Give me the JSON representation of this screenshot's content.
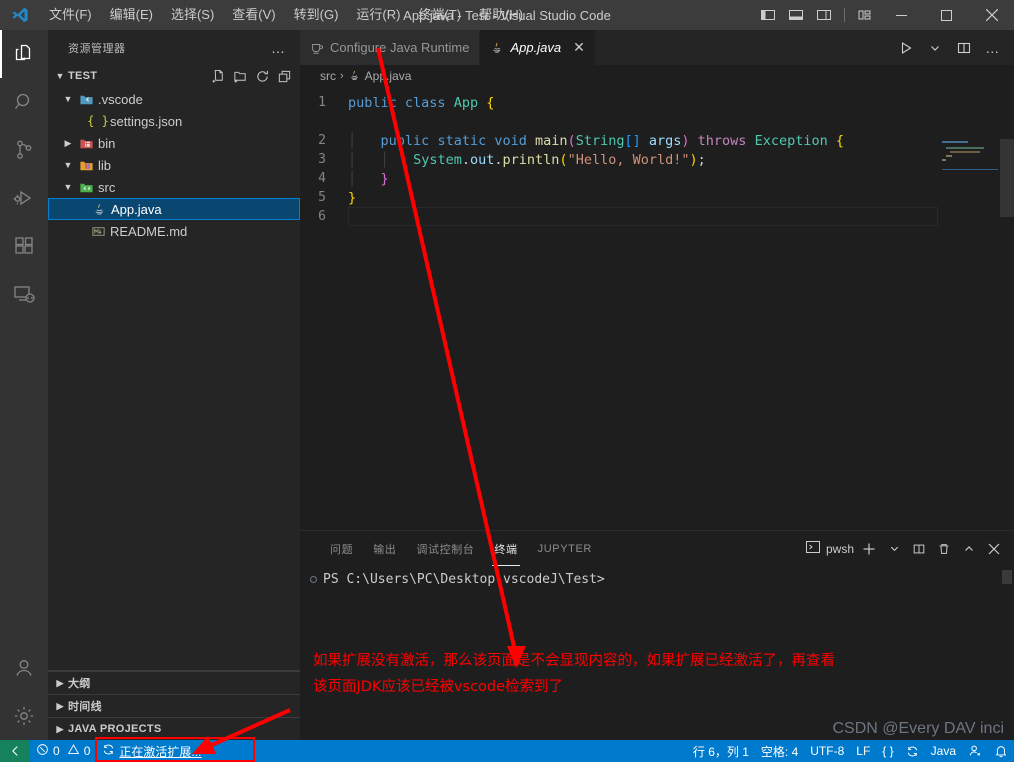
{
  "window": {
    "title": "App.java - Test - Visual Studio Code",
    "menus": [
      "文件(F)",
      "编辑(E)",
      "选择(S)",
      "查看(V)",
      "转到(G)",
      "运行(R)",
      "终端(T)",
      "帮助(H)"
    ],
    "controls": {
      "toggle_primary_sidebar": "toggle-primary-sidebar-icon",
      "toggle_panel": "toggle-panel-icon",
      "toggle_secondary_sidebar": "toggle-secondary-sidebar-icon",
      "customize_layout": "customize-layout-icon",
      "minimize": "–",
      "maximize": "▢",
      "close": "✕"
    }
  },
  "activitybar": {
    "items": [
      {
        "name": "explorer",
        "icon": "files-icon",
        "active": true
      },
      {
        "name": "search",
        "icon": "search-icon",
        "active": false
      },
      {
        "name": "source-control",
        "icon": "source-control-icon",
        "active": false
      },
      {
        "name": "run-and-debug",
        "icon": "run-debug-icon",
        "active": false
      },
      {
        "name": "extensions",
        "icon": "extensions-icon",
        "active": false
      },
      {
        "name": "remote-explorer",
        "icon": "remote-explorer-icon",
        "active": false
      }
    ],
    "bottom": [
      {
        "name": "accounts",
        "icon": "account-icon"
      },
      {
        "name": "manage",
        "icon": "gear-icon"
      }
    ]
  },
  "sidebar": {
    "title": "资源管理器",
    "more_actions": "…",
    "folder": {
      "name": "TEST",
      "expanded": true,
      "actions": [
        "new-file-icon",
        "new-folder-icon",
        "refresh-icon",
        "collapse-all-icon"
      ]
    },
    "tree": [
      {
        "label": ".vscode",
        "icon": "folder-vscode-icon",
        "indent": 1,
        "twisty": "▾",
        "selected": false
      },
      {
        "label": "settings.json",
        "icon": "json-icon",
        "indent": 2,
        "twisty": "",
        "selected": false
      },
      {
        "label": "bin",
        "icon": "folder-bin-icon",
        "indent": 1,
        "twisty": "▸",
        "selected": false
      },
      {
        "label": "lib",
        "icon": "folder-lib-icon",
        "indent": 1,
        "twisty": "▾",
        "selected": false
      },
      {
        "label": "src",
        "icon": "folder-src-icon",
        "indent": 1,
        "twisty": "▾",
        "selected": false
      },
      {
        "label": "App.java",
        "icon": "java-icon",
        "indent": 2,
        "twisty": "",
        "selected": true
      },
      {
        "label": "README.md",
        "icon": "markdown-icon",
        "indent": 2,
        "twisty": "",
        "selected": false
      }
    ],
    "sections": [
      {
        "label": "大纲",
        "twisty": "▸"
      },
      {
        "label": "时间线",
        "twisty": "▸"
      },
      {
        "label": "JAVA PROJECTS",
        "twisty": "▸"
      }
    ]
  },
  "editor": {
    "tabs": [
      {
        "label": "Configure Java Runtime",
        "icon": "coffee-icon",
        "active": false,
        "closable": false
      },
      {
        "label": "App.java",
        "icon": "java-icon",
        "active": true,
        "closable": true,
        "close": "✕"
      }
    ],
    "actions": [
      "run-icon",
      "chevron-down-icon",
      "split-editor-icon",
      "more-actions-icon"
    ],
    "breadcrumbs": [
      {
        "label": "src",
        "icon": ""
      },
      {
        "label": "App.java",
        "icon": "java-icon"
      }
    ],
    "breadcrumb_sep": "›",
    "lines": [
      {
        "num": "1",
        "text": "public class App {"
      },
      {
        "num": "",
        "text": ""
      },
      {
        "num": "2",
        "text": "    public static void main(String[] args) throws Exception {"
      },
      {
        "num": "3",
        "text": "        System.out.println(\"Hello, World!\");"
      },
      {
        "num": "4",
        "text": "    }"
      },
      {
        "num": "5",
        "text": "}"
      },
      {
        "num": "6",
        "text": ""
      }
    ]
  },
  "panel": {
    "tabs": [
      {
        "label": "问题",
        "active": false
      },
      {
        "label": "输出",
        "active": false
      },
      {
        "label": "调试控制台",
        "active": false
      },
      {
        "label": "终端",
        "active": true
      },
      {
        "label": "JUPYTER",
        "active": false
      }
    ],
    "terminal_name": "pwsh",
    "actions": [
      "new-terminal-icon",
      "chevron-down-icon",
      "split-terminal-icon",
      "kill-terminal-icon",
      "maximize-panel-icon",
      "close-panel-icon"
    ],
    "prompt": "PS C:\\Users\\PC\\Desktop\\vscodeJ\\Test>"
  },
  "statusbar": {
    "remote": "remote-window-icon",
    "problems": {
      "errors": "0",
      "warnings": "0",
      "error_icon": "error-icon",
      "warning_icon": "warning-icon"
    },
    "activating": {
      "label": "正在激活扩展...",
      "icon": "sync-spin-icon"
    },
    "right": [
      {
        "name": "editor-position",
        "label": "行 6，列 1"
      },
      {
        "name": "indentation",
        "label": "空格: 4"
      },
      {
        "name": "encoding",
        "label": "UTF-8"
      },
      {
        "name": "eol",
        "label": "LF"
      },
      {
        "name": "brackets",
        "label": "{ }"
      },
      {
        "name": "sync",
        "label": "sync-icon"
      },
      {
        "name": "language-mode",
        "label": "Java"
      },
      {
        "name": "feedback",
        "label": "feedback-icon"
      },
      {
        "name": "notifications",
        "label": "bell-icon"
      }
    ]
  },
  "annotations": {
    "note": "如果扩展没有激活，那么该页面是不会显现内容的，如果扩展已经激活了，再查看\n该页面JDK应该已经被vscode检索到了",
    "color": "#ff0000",
    "watermark": "CSDN @Every DAV inci"
  }
}
